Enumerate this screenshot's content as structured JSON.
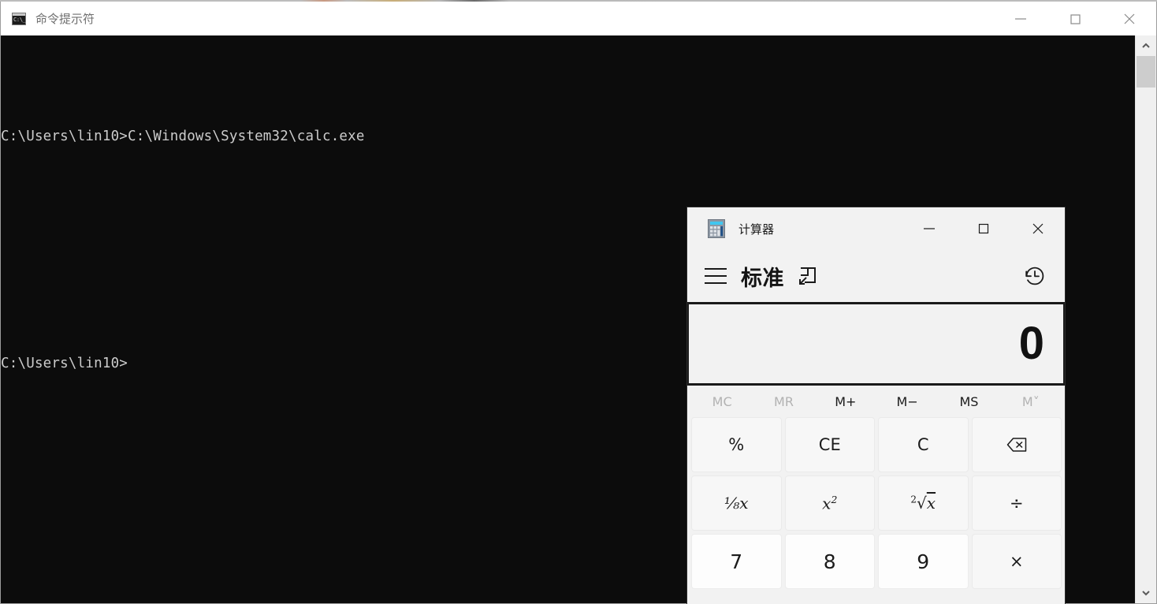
{
  "cmd_window": {
    "title": "命令提示符",
    "icon": "console-icon",
    "window_controls": [
      {
        "name": "minimize",
        "glyph": "minimize-icon"
      },
      {
        "name": "maximize",
        "glyph": "maximize-icon"
      },
      {
        "name": "close",
        "glyph": "close-icon"
      }
    ],
    "console_lines": [
      "C:\\Users\\lin10>C:\\Windows\\System32\\calc.exe",
      "",
      "C:\\Users\\lin10>"
    ],
    "scrollbar": {
      "up_arrow": "chevron-up-icon",
      "down_arrow": "chevron-down-icon"
    }
  },
  "calculator": {
    "title": "计算器",
    "icon": "calculator-app-icon",
    "window_controls": [
      {
        "name": "minimize",
        "glyph": "minimize-icon"
      },
      {
        "name": "maximize",
        "glyph": "maximize-icon"
      },
      {
        "name": "close",
        "glyph": "close-icon"
      }
    ],
    "header": {
      "menu_icon": "hamburger-icon",
      "mode_label": "标准",
      "keep_on_top_icon": "keep-on-top-icon",
      "history_icon": "history-clock-icon"
    },
    "display": {
      "value": "0"
    },
    "memory_row": [
      {
        "label": "MC",
        "enabled": false
      },
      {
        "label": "MR",
        "enabled": false
      },
      {
        "label": "M+",
        "enabled": true
      },
      {
        "label": "M−",
        "enabled": true
      },
      {
        "label": "MS",
        "enabled": true
      },
      {
        "label": "M˅",
        "enabled": false
      }
    ],
    "keypad": [
      [
        {
          "label": "%",
          "kind": "func"
        },
        {
          "label": "CE",
          "kind": "func"
        },
        {
          "label": "C",
          "kind": "func"
        },
        {
          "label": "",
          "kind": "func",
          "icon": "backspace-icon"
        }
      ],
      [
        {
          "label": "1/x",
          "kind": "math"
        },
        {
          "label": "x2",
          "kind": "math"
        },
        {
          "label": "2√x",
          "kind": "math"
        },
        {
          "label": "÷",
          "kind": "func"
        }
      ],
      [
        {
          "label": "7",
          "kind": "digit"
        },
        {
          "label": "8",
          "kind": "digit"
        },
        {
          "label": "9",
          "kind": "digit"
        },
        {
          "label": "×",
          "kind": "func"
        }
      ]
    ]
  },
  "colors": {
    "console_bg": "#0c0c0c",
    "console_text": "#cccccc",
    "calc_chrome": "#f2f2f2",
    "digit_key": "#fdfdfd",
    "func_key": "#f7f7f7",
    "disabled_text": "#b2b2b2"
  }
}
